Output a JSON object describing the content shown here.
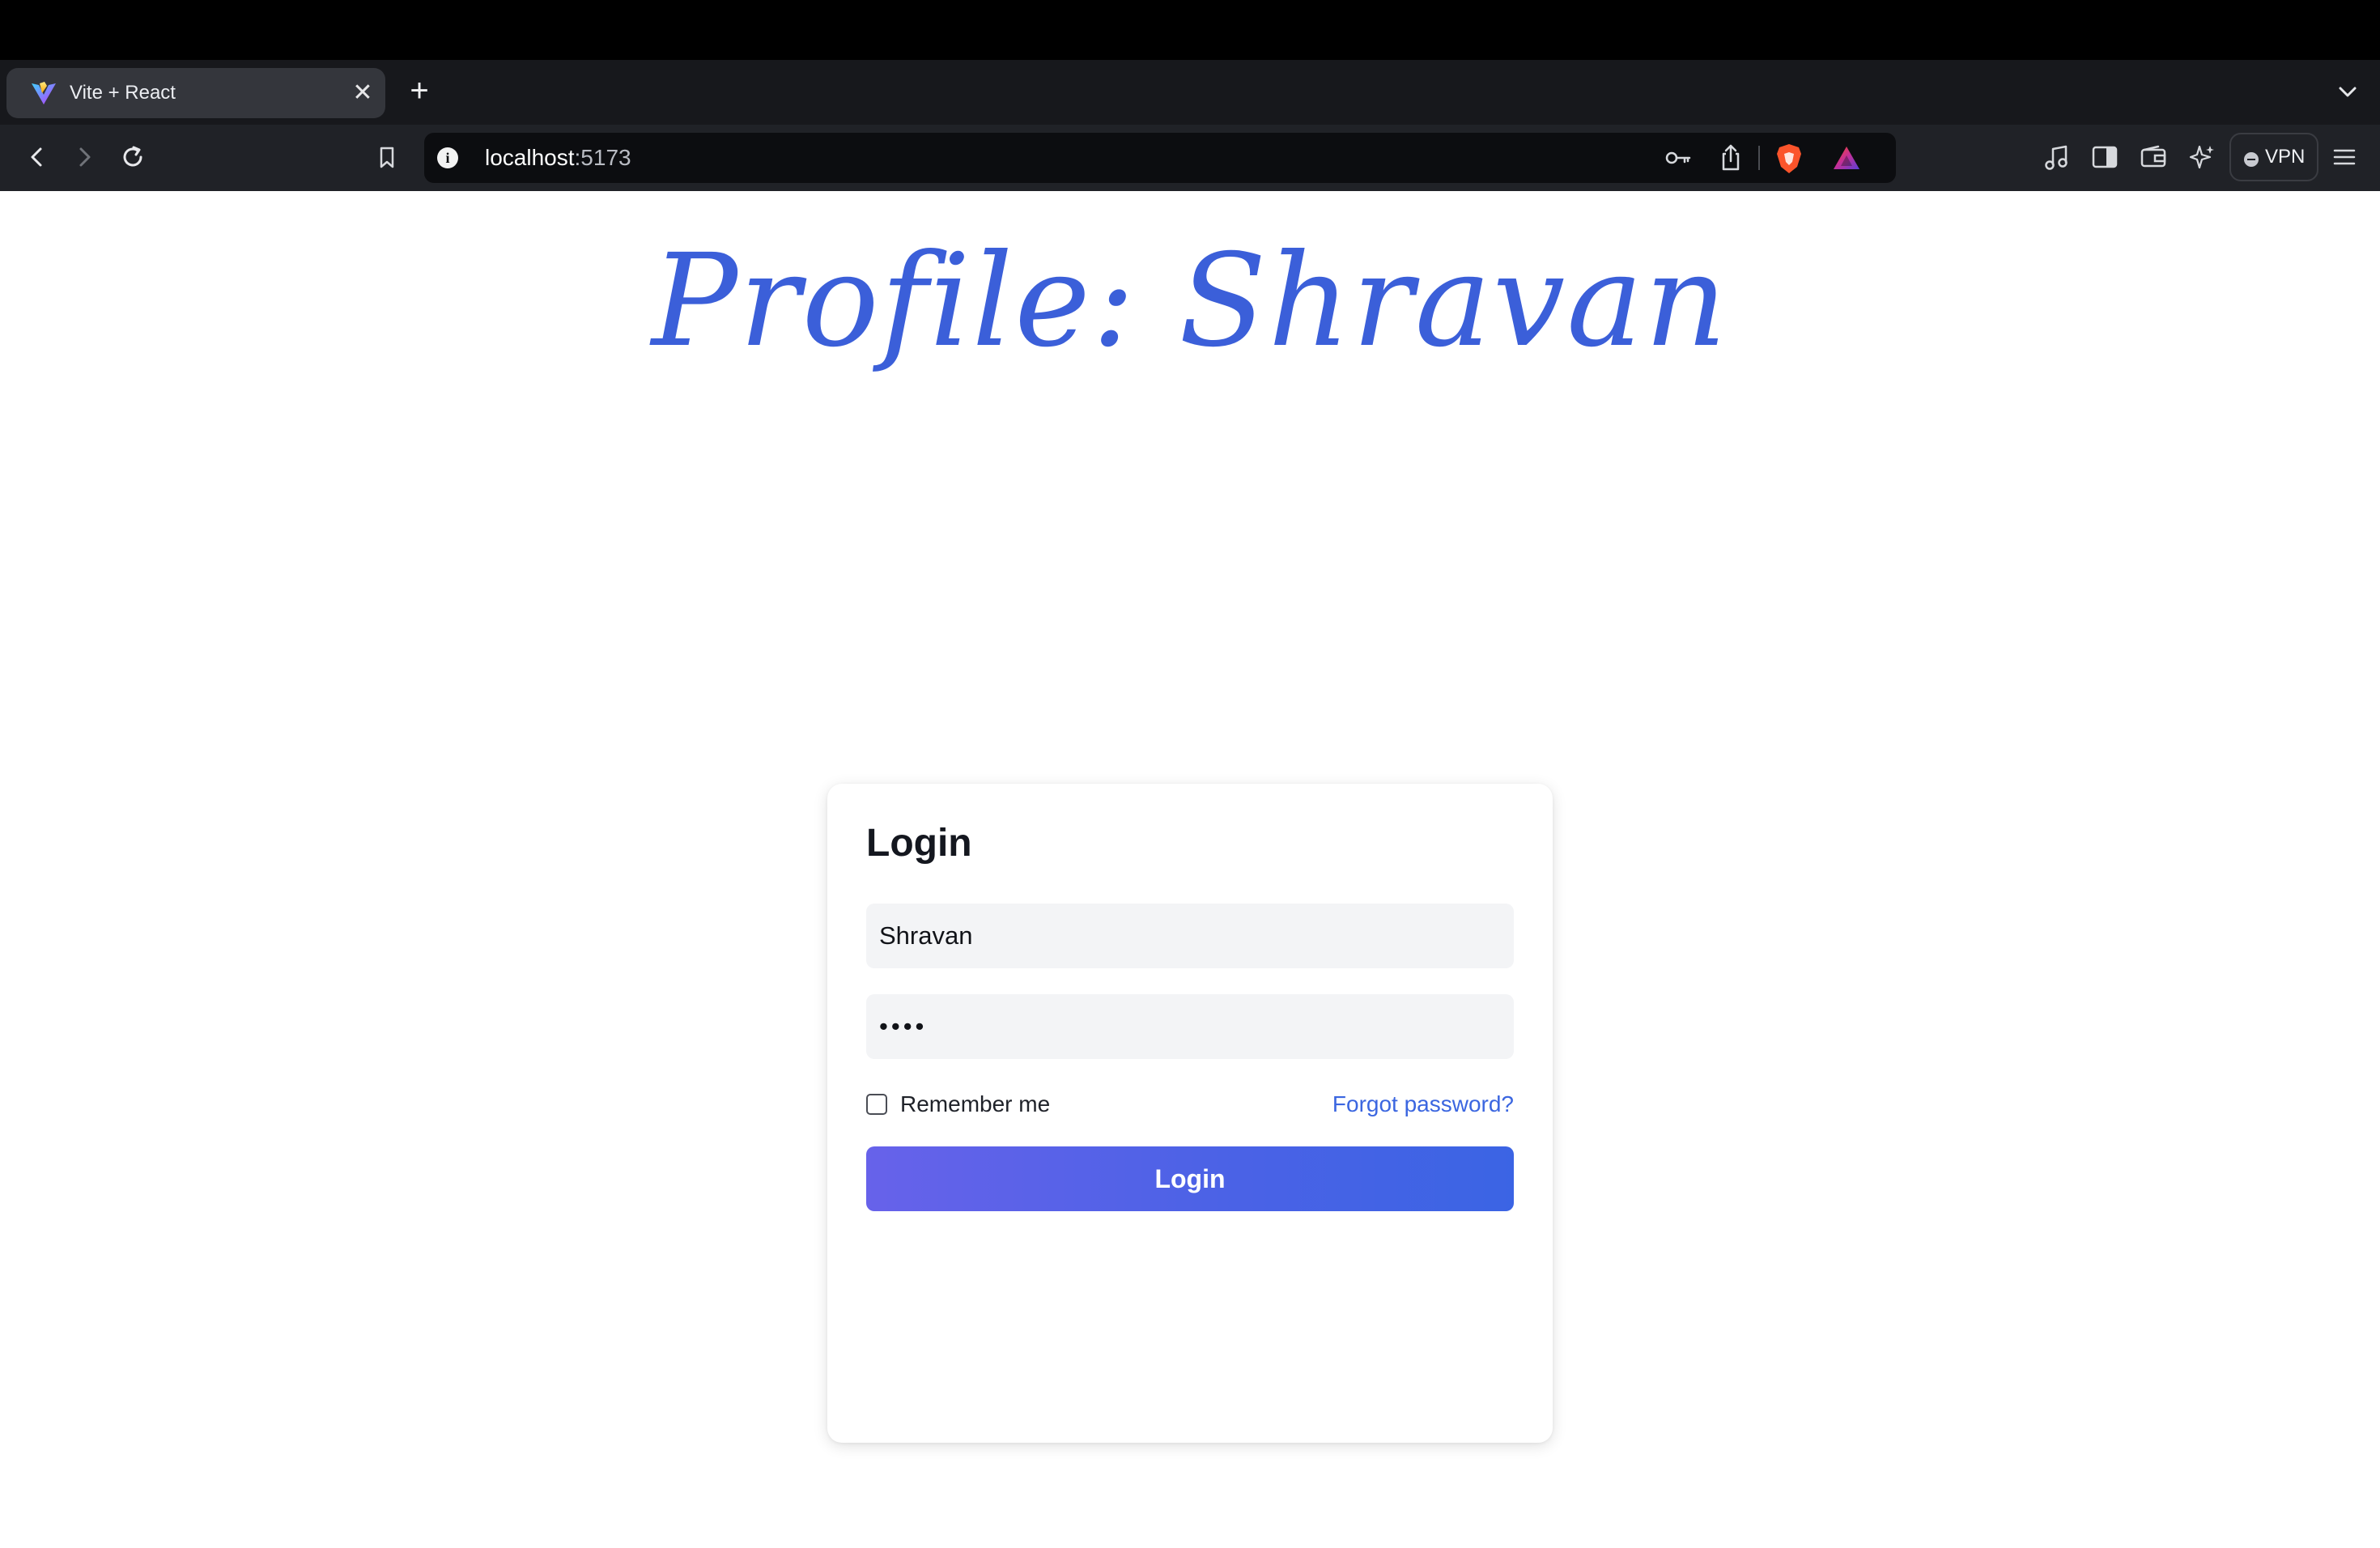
{
  "browser": {
    "tab": {
      "title": "Vite + React",
      "close_glyph": "✕"
    },
    "new_tab_glyph": "+",
    "url": {
      "host": "localhost",
      "port": ":5173"
    },
    "vpn_label": "VPN",
    "icons": {
      "tab_favicon": "vite-logo-icon",
      "back": "chevron-left-icon",
      "forward": "chevron-right-icon",
      "reload": "reload-icon",
      "bookmark": "bookmark-icon",
      "site_info": "info-icon",
      "password_key": "key-icon",
      "share": "share-icon",
      "brave_shield": "brave-shield-icon",
      "brave_rewards": "brave-rewards-icon",
      "media": "music-note-icon",
      "sidebar": "sidebar-icon",
      "wallet": "wallet-icon",
      "leo_ai": "sparkle-icon",
      "menu": "hamburger-menu-icon",
      "tab_list": "chevron-down-icon"
    }
  },
  "page": {
    "profile_title": "Profile: Shravan",
    "title_color": "#3b5fd9"
  },
  "login_card": {
    "heading": "Login",
    "username_value": "Shravan",
    "password_value": "••••",
    "remember_label": "Remember me",
    "remember_checked": false,
    "forgot_label": "Forgot password?",
    "submit_label": "Login",
    "accent_color": "#3b66e0"
  }
}
